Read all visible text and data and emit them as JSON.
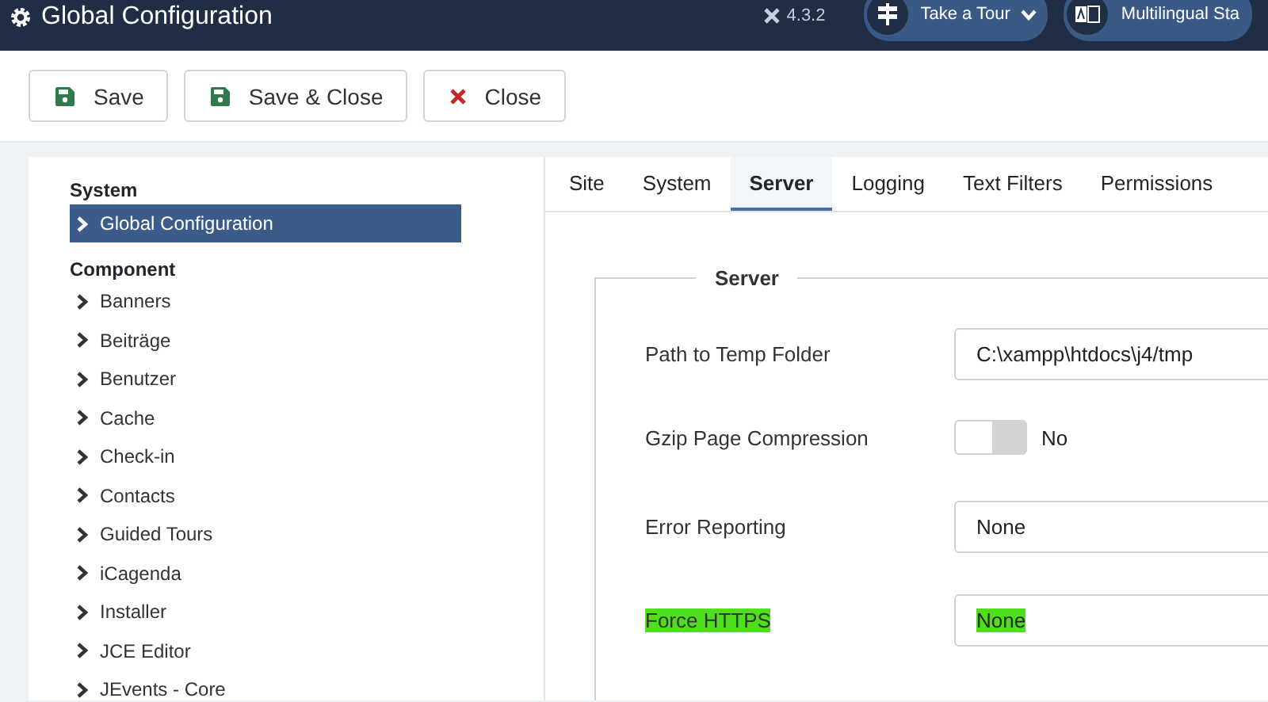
{
  "header": {
    "title": "Global Configuration",
    "version": "4.3.2",
    "pills": [
      {
        "label": "Take a Tour",
        "kind": "tour"
      },
      {
        "label": "Multilingual Sta",
        "kind": "lang"
      }
    ]
  },
  "toolbar": {
    "buttons": [
      {
        "label": "Save",
        "kind": "save"
      },
      {
        "label": "Save & Close",
        "kind": "save"
      },
      {
        "label": "Close",
        "kind": "close"
      }
    ]
  },
  "sidebar": {
    "sections": [
      {
        "heading": "System",
        "items": [
          {
            "label": "Global Configuration",
            "selected": true
          }
        ]
      },
      {
        "heading": "Component",
        "items": [
          {
            "label": "Banners",
            "selected": false
          },
          {
            "label": "Beiträge",
            "selected": false
          },
          {
            "label": "Benutzer",
            "selected": false
          },
          {
            "label": "Cache",
            "selected": false
          },
          {
            "label": "Check-in",
            "selected": false
          },
          {
            "label": "Contacts",
            "selected": false
          },
          {
            "label": "Guided Tours",
            "selected": false
          },
          {
            "label": "iCagenda",
            "selected": false
          },
          {
            "label": "Installer",
            "selected": false
          },
          {
            "label": "JCE Editor",
            "selected": false
          },
          {
            "label": "JEvents - Core",
            "selected": false
          }
        ]
      }
    ]
  },
  "tabs": [
    {
      "label": "Site",
      "selected": false
    },
    {
      "label": "System",
      "selected": false
    },
    {
      "label": "Server",
      "selected": true
    },
    {
      "label": "Logging",
      "selected": false
    },
    {
      "label": "Text Filters",
      "selected": false
    },
    {
      "label": "Permissions",
      "selected": false
    }
  ],
  "fieldset": {
    "legend": "Server",
    "fields": [
      {
        "label": "Path to Temp Folder",
        "kind": "text",
        "value": "C:\\xampp\\htdocs\\j4/tmp",
        "highlighted": false
      },
      {
        "label": "Gzip Page Compression",
        "kind": "toggle",
        "on": false,
        "value": "No",
        "highlighted": false
      },
      {
        "label": "Error Reporting",
        "kind": "select",
        "value": "None",
        "highlighted": false
      },
      {
        "label": "Force HTTPS",
        "kind": "select",
        "value": "None",
        "highlighted": true
      }
    ]
  }
}
